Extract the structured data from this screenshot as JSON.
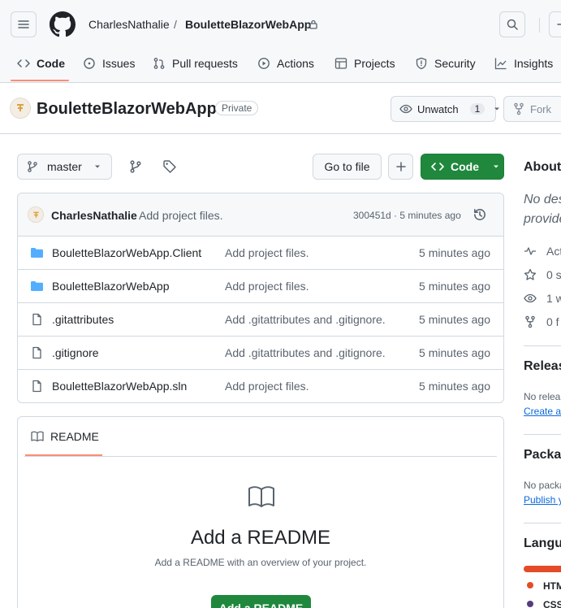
{
  "header": {
    "owner": "CharlesNathalie",
    "separator": "/",
    "repo": "BouletteBlazorWebApp"
  },
  "tabs": [
    {
      "label": "Code",
      "icon": "code-icon"
    },
    {
      "label": "Issues",
      "icon": "issue-icon"
    },
    {
      "label": "Pull requests",
      "icon": "pull-request-icon"
    },
    {
      "label": "Actions",
      "icon": "play-icon"
    },
    {
      "label": "Projects",
      "icon": "table-icon"
    },
    {
      "label": "Security",
      "icon": "shield-icon"
    },
    {
      "label": "Insights",
      "icon": "graph-icon"
    }
  ],
  "repo": {
    "name": "BouletteBlazorWebApp",
    "visibility": "Private",
    "watch_label": "Unwatch",
    "watch_count": "1",
    "fork_label": "Fork"
  },
  "toolbar": {
    "branch": "master",
    "go_to_file": "Go to file",
    "code_label": "Code"
  },
  "commit": {
    "author": "CharlesNathalie",
    "message": "Add project files.",
    "hash_time": "300451d · 5 minutes ago"
  },
  "files": [
    {
      "type": "folder",
      "name": "BouletteBlazorWebApp.Client",
      "message": "Add project files.",
      "time": "5 minutes ago"
    },
    {
      "type": "folder",
      "name": "BouletteBlazorWebApp",
      "message": "Add project files.",
      "time": "5 minutes ago"
    },
    {
      "type": "file",
      "name": ".gitattributes",
      "message": "Add .gitattributes and .gitignore.",
      "time": "5 minutes ago"
    },
    {
      "type": "file",
      "name": ".gitignore",
      "message": "Add .gitattributes and .gitignore.",
      "time": "5 minutes ago"
    },
    {
      "type": "file",
      "name": "BouletteBlazorWebApp.sln",
      "message": "Add project files.",
      "time": "5 minutes ago"
    }
  ],
  "readme": {
    "tab_label": "README",
    "heading": "Add a README",
    "description": "Add a README with an overview of your project.",
    "button": "Add a README"
  },
  "sidebar": {
    "about": "About",
    "desc_line1": "No des",
    "desc_line2": "provide",
    "activity": "Act",
    "stars": "0 s",
    "watching": "1 w",
    "forks": "0 f",
    "releases": "Releas",
    "releases_text": "No relea",
    "releases_link": "Create a",
    "packages": "Packag",
    "packages_text": "No packa",
    "packages_link": "Publish y",
    "languages": "Langua",
    "lang1": "HTM",
    "lang2": "CSS"
  },
  "colors": {
    "accent": "#1f883d",
    "link": "#0969da",
    "underline": "#fd8c73",
    "lang_html": "#e34c26",
    "lang_css": "#563d7c",
    "folder": "#54aeff"
  }
}
